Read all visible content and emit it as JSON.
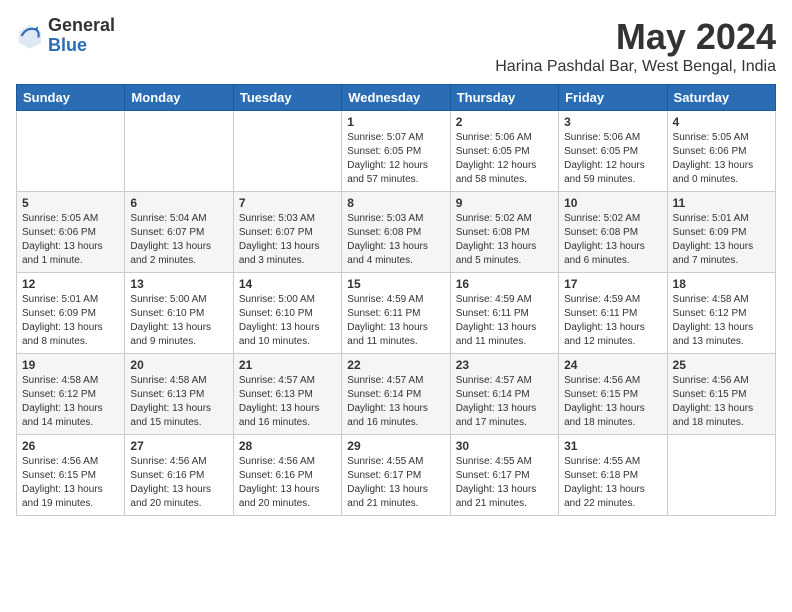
{
  "logo": {
    "general": "General",
    "blue": "Blue"
  },
  "header": {
    "month": "May 2024",
    "location": "Harina Pashdal Bar, West Bengal, India"
  },
  "weekdays": [
    "Sunday",
    "Monday",
    "Tuesday",
    "Wednesday",
    "Thursday",
    "Friday",
    "Saturday"
  ],
  "weeks": [
    [
      {
        "day": "",
        "info": ""
      },
      {
        "day": "",
        "info": ""
      },
      {
        "day": "",
        "info": ""
      },
      {
        "day": "1",
        "info": "Sunrise: 5:07 AM\nSunset: 6:05 PM\nDaylight: 12 hours and 57 minutes."
      },
      {
        "day": "2",
        "info": "Sunrise: 5:06 AM\nSunset: 6:05 PM\nDaylight: 12 hours and 58 minutes."
      },
      {
        "day": "3",
        "info": "Sunrise: 5:06 AM\nSunset: 6:05 PM\nDaylight: 12 hours and 59 minutes."
      },
      {
        "day": "4",
        "info": "Sunrise: 5:05 AM\nSunset: 6:06 PM\nDaylight: 13 hours and 0 minutes."
      }
    ],
    [
      {
        "day": "5",
        "info": "Sunrise: 5:05 AM\nSunset: 6:06 PM\nDaylight: 13 hours and 1 minute."
      },
      {
        "day": "6",
        "info": "Sunrise: 5:04 AM\nSunset: 6:07 PM\nDaylight: 13 hours and 2 minutes."
      },
      {
        "day": "7",
        "info": "Sunrise: 5:03 AM\nSunset: 6:07 PM\nDaylight: 13 hours and 3 minutes."
      },
      {
        "day": "8",
        "info": "Sunrise: 5:03 AM\nSunset: 6:08 PM\nDaylight: 13 hours and 4 minutes."
      },
      {
        "day": "9",
        "info": "Sunrise: 5:02 AM\nSunset: 6:08 PM\nDaylight: 13 hours and 5 minutes."
      },
      {
        "day": "10",
        "info": "Sunrise: 5:02 AM\nSunset: 6:08 PM\nDaylight: 13 hours and 6 minutes."
      },
      {
        "day": "11",
        "info": "Sunrise: 5:01 AM\nSunset: 6:09 PM\nDaylight: 13 hours and 7 minutes."
      }
    ],
    [
      {
        "day": "12",
        "info": "Sunrise: 5:01 AM\nSunset: 6:09 PM\nDaylight: 13 hours and 8 minutes."
      },
      {
        "day": "13",
        "info": "Sunrise: 5:00 AM\nSunset: 6:10 PM\nDaylight: 13 hours and 9 minutes."
      },
      {
        "day": "14",
        "info": "Sunrise: 5:00 AM\nSunset: 6:10 PM\nDaylight: 13 hours and 10 minutes."
      },
      {
        "day": "15",
        "info": "Sunrise: 4:59 AM\nSunset: 6:11 PM\nDaylight: 13 hours and 11 minutes."
      },
      {
        "day": "16",
        "info": "Sunrise: 4:59 AM\nSunset: 6:11 PM\nDaylight: 13 hours and 11 minutes."
      },
      {
        "day": "17",
        "info": "Sunrise: 4:59 AM\nSunset: 6:11 PM\nDaylight: 13 hours and 12 minutes."
      },
      {
        "day": "18",
        "info": "Sunrise: 4:58 AM\nSunset: 6:12 PM\nDaylight: 13 hours and 13 minutes."
      }
    ],
    [
      {
        "day": "19",
        "info": "Sunrise: 4:58 AM\nSunset: 6:12 PM\nDaylight: 13 hours and 14 minutes."
      },
      {
        "day": "20",
        "info": "Sunrise: 4:58 AM\nSunset: 6:13 PM\nDaylight: 13 hours and 15 minutes."
      },
      {
        "day": "21",
        "info": "Sunrise: 4:57 AM\nSunset: 6:13 PM\nDaylight: 13 hours and 16 minutes."
      },
      {
        "day": "22",
        "info": "Sunrise: 4:57 AM\nSunset: 6:14 PM\nDaylight: 13 hours and 16 minutes."
      },
      {
        "day": "23",
        "info": "Sunrise: 4:57 AM\nSunset: 6:14 PM\nDaylight: 13 hours and 17 minutes."
      },
      {
        "day": "24",
        "info": "Sunrise: 4:56 AM\nSunset: 6:15 PM\nDaylight: 13 hours and 18 minutes."
      },
      {
        "day": "25",
        "info": "Sunrise: 4:56 AM\nSunset: 6:15 PM\nDaylight: 13 hours and 18 minutes."
      }
    ],
    [
      {
        "day": "26",
        "info": "Sunrise: 4:56 AM\nSunset: 6:15 PM\nDaylight: 13 hours and 19 minutes."
      },
      {
        "day": "27",
        "info": "Sunrise: 4:56 AM\nSunset: 6:16 PM\nDaylight: 13 hours and 20 minutes."
      },
      {
        "day": "28",
        "info": "Sunrise: 4:56 AM\nSunset: 6:16 PM\nDaylight: 13 hours and 20 minutes."
      },
      {
        "day": "29",
        "info": "Sunrise: 4:55 AM\nSunset: 6:17 PM\nDaylight: 13 hours and 21 minutes."
      },
      {
        "day": "30",
        "info": "Sunrise: 4:55 AM\nSunset: 6:17 PM\nDaylight: 13 hours and 21 minutes."
      },
      {
        "day": "31",
        "info": "Sunrise: 4:55 AM\nSunset: 6:18 PM\nDaylight: 13 hours and 22 minutes."
      },
      {
        "day": "",
        "info": ""
      }
    ]
  ]
}
